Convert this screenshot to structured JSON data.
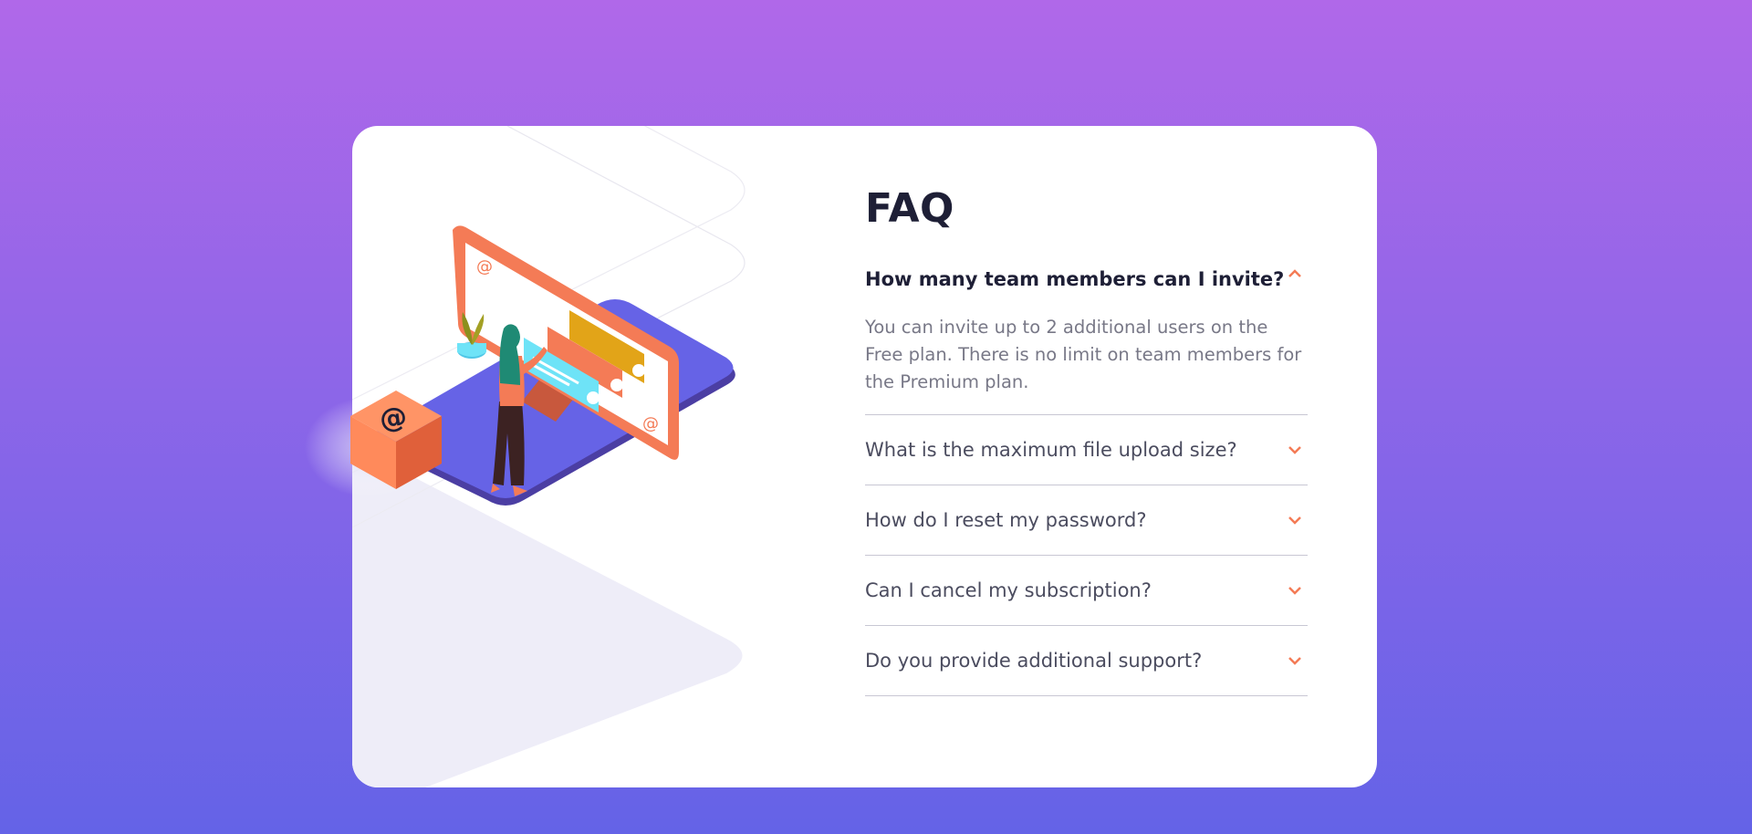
{
  "page": {
    "background_top": "#b068e9",
    "background_bottom": "#6463e7"
  },
  "faq": {
    "title": "FAQ",
    "accent_color": "#f47b56",
    "items": [
      {
        "question": "How many team members can I invite?",
        "answer": "You can invite up to 2 additional users on the Free plan. There is no limit on team members for the Premium plan.",
        "open": true,
        "icon": "chevron-up-icon"
      },
      {
        "question": "What is the maximum file upload size?",
        "open": false,
        "icon": "chevron-down-icon"
      },
      {
        "question": "How do I reset my password?",
        "open": false,
        "icon": "chevron-down-icon"
      },
      {
        "question": "Can I cancel my subscription?",
        "open": false,
        "icon": "chevron-down-icon"
      },
      {
        "question": "Do you provide additional support?",
        "open": false,
        "icon": "chevron-down-icon"
      }
    ]
  },
  "illustration": {
    "icon": "woman-at-computer-illustration",
    "box_icon": "at-sign-box-icon"
  }
}
